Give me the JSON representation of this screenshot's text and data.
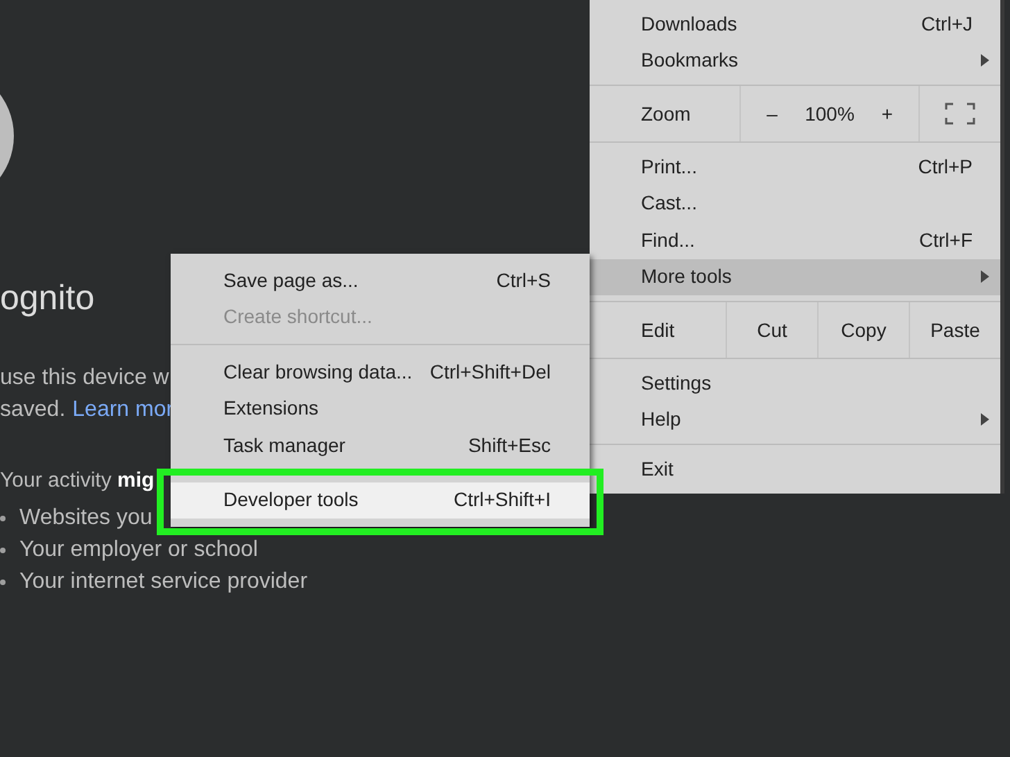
{
  "page": {
    "heading": "ognito",
    "description": {
      "line_1": "use this device w",
      "line_2": "saved.",
      "link": "Learn mor"
    },
    "activity": "Your activity **mig**",
    "bullets": [
      "Websites you",
      "Your employer or school",
      "Your internet service provider"
    ]
  },
  "main_menu": {
    "sections": [
      {
        "items": [
          {
            "kind": "item",
            "label": "Downloads",
            "shortcut": "Ctrl+J",
            "submenu": false,
            "selected": false
          },
          {
            "kind": "item",
            "label": "Bookmarks",
            "submenu": true,
            "selected": false
          }
        ]
      },
      {
        "items": [
          {
            "kind": "zoom",
            "label": "Zoom",
            "minus": "–",
            "value": "100%",
            "plus": "+"
          }
        ]
      },
      {
        "items": [
          {
            "kind": "item",
            "label": "Print...",
            "shortcut": "Ctrl+P",
            "submenu": false,
            "selected": false
          },
          {
            "kind": "item",
            "label": "Cast...",
            "submenu": false,
            "selected": false
          },
          {
            "kind": "item",
            "label": "Find...",
            "shortcut": "Ctrl+F",
            "submenu": false,
            "selected": false
          },
          {
            "kind": "item",
            "label": "More tools",
            "submenu": true,
            "selected": true
          }
        ]
      },
      {
        "items": [
          {
            "kind": "edit",
            "label": "Edit",
            "actions": [
              "Cut",
              "Copy",
              "Paste"
            ]
          }
        ]
      },
      {
        "items": [
          {
            "kind": "item",
            "label": "Settings",
            "submenu": false,
            "selected": false
          },
          {
            "kind": "item",
            "label": "Help",
            "submenu": true,
            "selected": false
          }
        ]
      },
      {
        "items": [
          {
            "kind": "item",
            "label": "Exit",
            "submenu": false,
            "selected": false
          }
        ]
      }
    ]
  },
  "more_tools_menu": {
    "sections": [
      {
        "items": [
          {
            "label": "Save page as...",
            "shortcut": "Ctrl+S",
            "disabled": false,
            "selected": false,
            "outlined": false
          },
          {
            "label": "Create shortcut...",
            "disabled": true,
            "selected": false,
            "outlined": false
          }
        ]
      },
      {
        "items": [
          {
            "label": "Clear browsing data...",
            "shortcut": "Ctrl+Shift+Del",
            "disabled": false,
            "selected": false,
            "outlined": false
          },
          {
            "label": "Extensions",
            "disabled": false,
            "selected": false,
            "outlined": false
          },
          {
            "label": "Task manager",
            "shortcut": "Shift+Esc",
            "disabled": false,
            "selected": false,
            "outlined": false
          }
        ]
      },
      {
        "items": [
          {
            "label": "Developer tools",
            "shortcut": "Ctrl+Shift+I",
            "disabled": false,
            "selected": true,
            "outlined": true
          }
        ]
      }
    ]
  }
}
